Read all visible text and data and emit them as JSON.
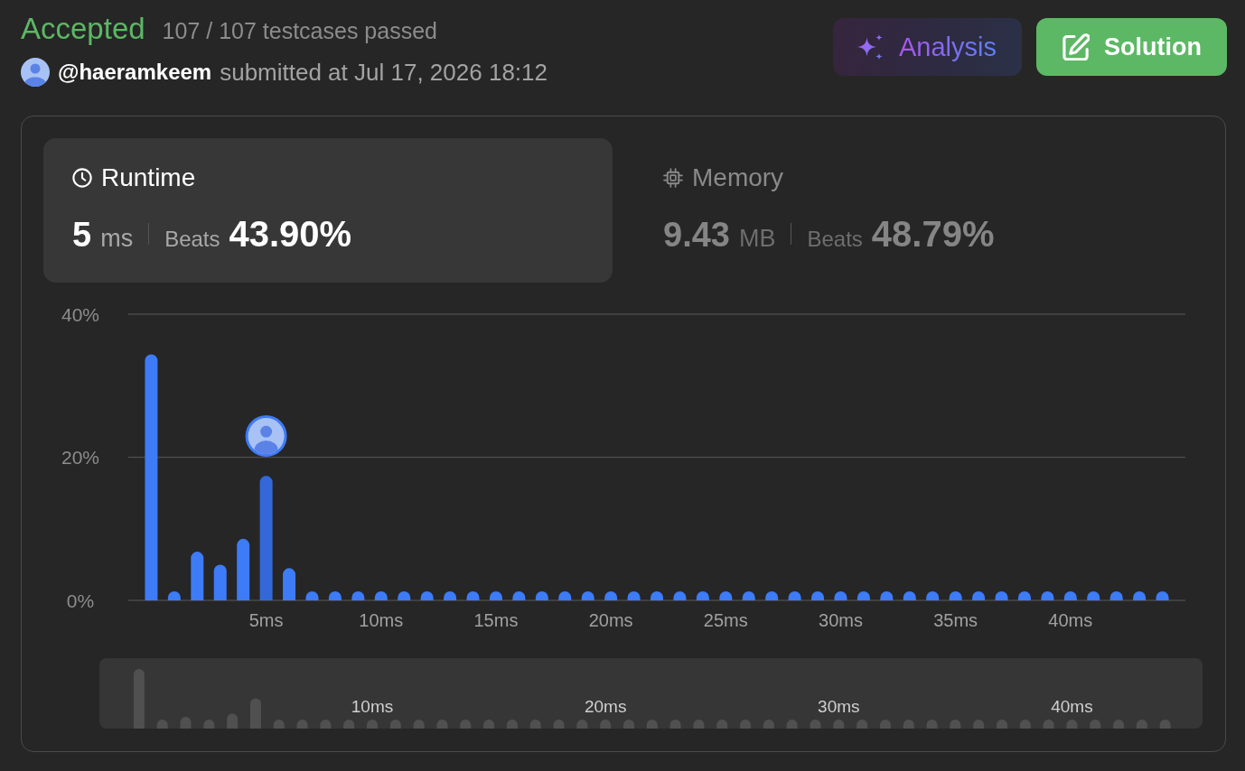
{
  "status": {
    "kind": "accepted",
    "verdict": "Accepted",
    "detail": "107 / 107 testcases passed"
  },
  "submission": {
    "author": "@haeramkeem",
    "text": "submitted at Jul 17, 2026 18:12"
  },
  "actions": [
    {
      "kind": "analysis",
      "label": "Analysis"
    },
    {
      "kind": "solution",
      "label": "Solution"
    }
  ],
  "metrics": [
    {
      "kind": "runtime",
      "title": "Runtime",
      "value": "5",
      "unit": "ms",
      "beats_label": "Beats",
      "beats": "43.90%",
      "selected": true
    },
    {
      "kind": "memory",
      "title": "Memory",
      "value": "9.43",
      "unit": "MB",
      "beats_label": "Beats",
      "beats": "48.79%",
      "selected": false
    }
  ],
  "distribution": {
    "chart_data": {
      "type": "bar",
      "stacked": true,
      "x": [
        0,
        1,
        2,
        3,
        4,
        5,
        6,
        7,
        8,
        9,
        10,
        11,
        12,
        13,
        14,
        15,
        16,
        17,
        18,
        19,
        20,
        21,
        22,
        23,
        24,
        25,
        26,
        27,
        28,
        29,
        30,
        31,
        32,
        33,
        34,
        35,
        36,
        37,
        38,
        39,
        40,
        41,
        42,
        43,
        44
      ],
      "series": [
        {
          "color": "#3d7bf7",
          "values": [
            34.4,
            1.2,
            6.8,
            5.0,
            8.6,
            0,
            4.5,
            1.2,
            1.2,
            1.2,
            1.2,
            1.2,
            1.2,
            1.2,
            1.2,
            1.2,
            1.2,
            1.2,
            1.2,
            1.2,
            1.2,
            1.2,
            1.2,
            1.2,
            1.2,
            1.2,
            1.2,
            1.2,
            1.2,
            1.2,
            1.2,
            1.2,
            1.2,
            1.2,
            1.2,
            1.2,
            1.2,
            1.2,
            1.2,
            1.2,
            1.2,
            1.2,
            1.2,
            1.2,
            1.2
          ]
        },
        {
          "color": "#3468d8",
          "values": [
            0,
            0,
            0,
            0,
            0,
            17.4,
            0,
            0,
            0,
            0,
            0,
            0,
            0,
            0,
            0,
            0,
            0,
            0,
            0,
            0,
            0,
            0,
            0,
            0,
            0,
            0,
            0,
            0,
            0,
            0,
            0,
            0,
            0,
            0,
            0,
            0,
            0,
            0,
            0,
            0,
            0,
            0,
            0,
            0,
            0
          ]
        }
      ],
      "xlim": [
        -1,
        45
      ],
      "ylim": [
        0,
        40
      ],
      "xticks": [
        {
          "value": 5,
          "label": "5ms"
        },
        {
          "value": 10,
          "label": "10ms"
        },
        {
          "value": 15,
          "label": "15ms"
        },
        {
          "value": 20,
          "label": "20ms"
        },
        {
          "value": 25,
          "label": "25ms"
        },
        {
          "value": 30,
          "label": "30ms"
        },
        {
          "value": 35,
          "label": "35ms"
        },
        {
          "value": 40,
          "label": "40ms"
        }
      ],
      "yticks": [
        {
          "value": 0,
          "label": "0%"
        },
        {
          "value": 20,
          "label": "20%"
        },
        {
          "value": 40,
          "label": "40%"
        }
      ]
    }
  },
  "overview": {
    "tick_labels": [
      "10ms",
      "20ms",
      "30ms",
      "40ms"
    ]
  }
}
